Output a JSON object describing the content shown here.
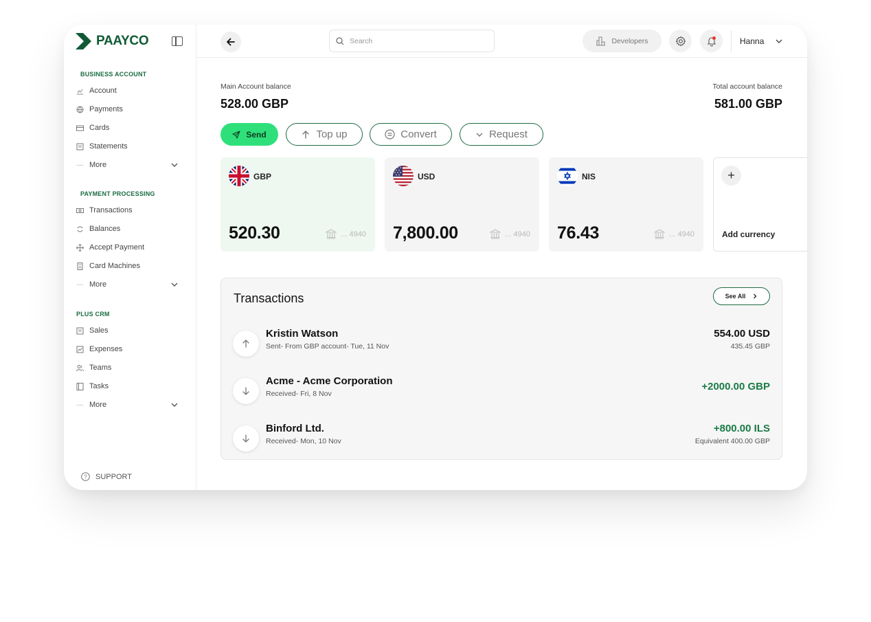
{
  "brand": {
    "name": "PAAYCO"
  },
  "sidebar": {
    "sections": [
      {
        "label": "BUSINESS ACCOUNT",
        "items": [
          {
            "label": "Account",
            "icon": "chart-icon"
          },
          {
            "label": "Payments",
            "icon": "globe-icon"
          },
          {
            "label": "Cards",
            "icon": "card-icon"
          },
          {
            "label": "Statements",
            "icon": "document-icon"
          },
          {
            "label": "More",
            "icon": "ellipsis-icon"
          }
        ]
      },
      {
        "label": "PAYMENT PROCESSING",
        "items": [
          {
            "label": "Transactions",
            "icon": "money-icon"
          },
          {
            "label": "Balances",
            "icon": "refresh-icon"
          },
          {
            "label": "Accept Payment",
            "icon": "move-icon"
          },
          {
            "label": "Card Machines",
            "icon": "terminal-icon"
          },
          {
            "label": "More",
            "icon": "ellipsis-icon"
          }
        ]
      },
      {
        "label": "PLUS CRM",
        "items": [
          {
            "label": "Sales",
            "icon": "document-icon"
          },
          {
            "label": "Expenses",
            "icon": "chart-icon"
          },
          {
            "label": "Teams",
            "icon": "users-icon"
          },
          {
            "label": "Tasks",
            "icon": "book-icon"
          },
          {
            "label": "More",
            "icon": "ellipsis-icon"
          }
        ]
      }
    ],
    "support_label": "SUPPORT"
  },
  "topbar": {
    "search_placeholder": "Search",
    "developers_label": "Developers",
    "user_name": "Hanna"
  },
  "balances": {
    "main_label": "Main Account balance",
    "main_value": "528.00 GBP",
    "total_label": "Total account balance",
    "total_value": "581.00 GBP"
  },
  "actions": {
    "send": "Send",
    "topup": "Top up",
    "convert": "Convert",
    "request": "Request"
  },
  "currencies": [
    {
      "code": "GBP",
      "amount": "520.30",
      "account": "... 4940",
      "flag": "uk-flag"
    },
    {
      "code": "USD",
      "amount": "7,800.00",
      "account": "... 4940",
      "flag": "us-flag"
    },
    {
      "code": "NIS",
      "amount": "76.43",
      "account": "... 4940",
      "flag": "israel-flag"
    }
  ],
  "add_currency_label": "Add currency",
  "transactions": {
    "title": "Transactions",
    "see_all": "See All",
    "rows": [
      {
        "name": "Kristin Watson",
        "sub": "Sent- From GBP account- Tue, 11 Nov",
        "amount": "554.00 USD",
        "amount_sub": "435.45 GBP",
        "direction": "up"
      },
      {
        "name": "Acme - Acme Corporation",
        "sub": "Received- Fri, 8 Nov",
        "amount": "+2000.00 GBP",
        "amount_sub": "",
        "direction": "down"
      },
      {
        "name": "Binford Ltd.",
        "sub": "Received- Mon, 10 Nov",
        "amount": "+800.00 ILS",
        "amount_sub": "Equivalent 400.00 GBP",
        "direction": "down"
      }
    ]
  },
  "colors": {
    "brand": "#0f5a34",
    "accent": "#2fe07a",
    "positive": "#1a7a47",
    "notification": "#e53935"
  }
}
